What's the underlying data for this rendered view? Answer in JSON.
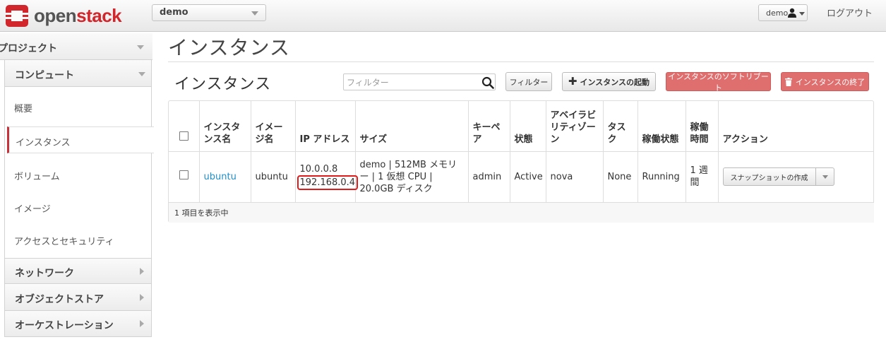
{
  "header": {
    "brand_prefix": "open",
    "brand_suffix": "stack",
    "project": "demo",
    "user": "demo",
    "logout": "ログアウト"
  },
  "sidebar": {
    "section": "プロジェクト",
    "subsection": "コンピュート",
    "items": [
      "概要",
      "インスタンス",
      "ボリューム",
      "イメージ",
      "アクセスとセキュリティ"
    ],
    "active_item": "インスタンス",
    "categories": [
      "ネットワーク",
      "オブジェクトストア",
      "オーケストレーション"
    ]
  },
  "page": {
    "title": "インスタンス",
    "table_title": "インスタンス",
    "filter_placeholder": "フィルター",
    "filter_button": "フィルター",
    "launch_button": "インスタンスの起動",
    "soft_reboot_button": "インスタンスのソフトリブート",
    "terminate_button": "インスタンスの終了"
  },
  "colors": {
    "accent_red": "#c7323a",
    "danger_button": "#df6e6e",
    "link": "#1f8ec9",
    "highlight_circle": "#e01b1b"
  },
  "table": {
    "columns": [
      "インスタンス名",
      "イメージ名",
      "IP アドレス",
      "サイズ",
      "キーペア",
      "状態",
      "アベイラビリティゾーン",
      "タスク",
      "稼働状態",
      "稼働時間",
      "アクション"
    ],
    "rows": [
      {
        "name": "ubuntu",
        "image": "ubuntu",
        "ip_fixed": "10.0.0.8",
        "ip_floating": "192.168.0.4",
        "size": "demo | 512MB メモリー | 1 仮想 CPU | 20.0GB ディスク",
        "keypair": "admin",
        "status": "Active",
        "zone": "nova",
        "task": "None",
        "power_state": "Running",
        "uptime": "1 週間",
        "action": "スナップショットの作成"
      }
    ],
    "footer": "1 項目を表示中"
  }
}
